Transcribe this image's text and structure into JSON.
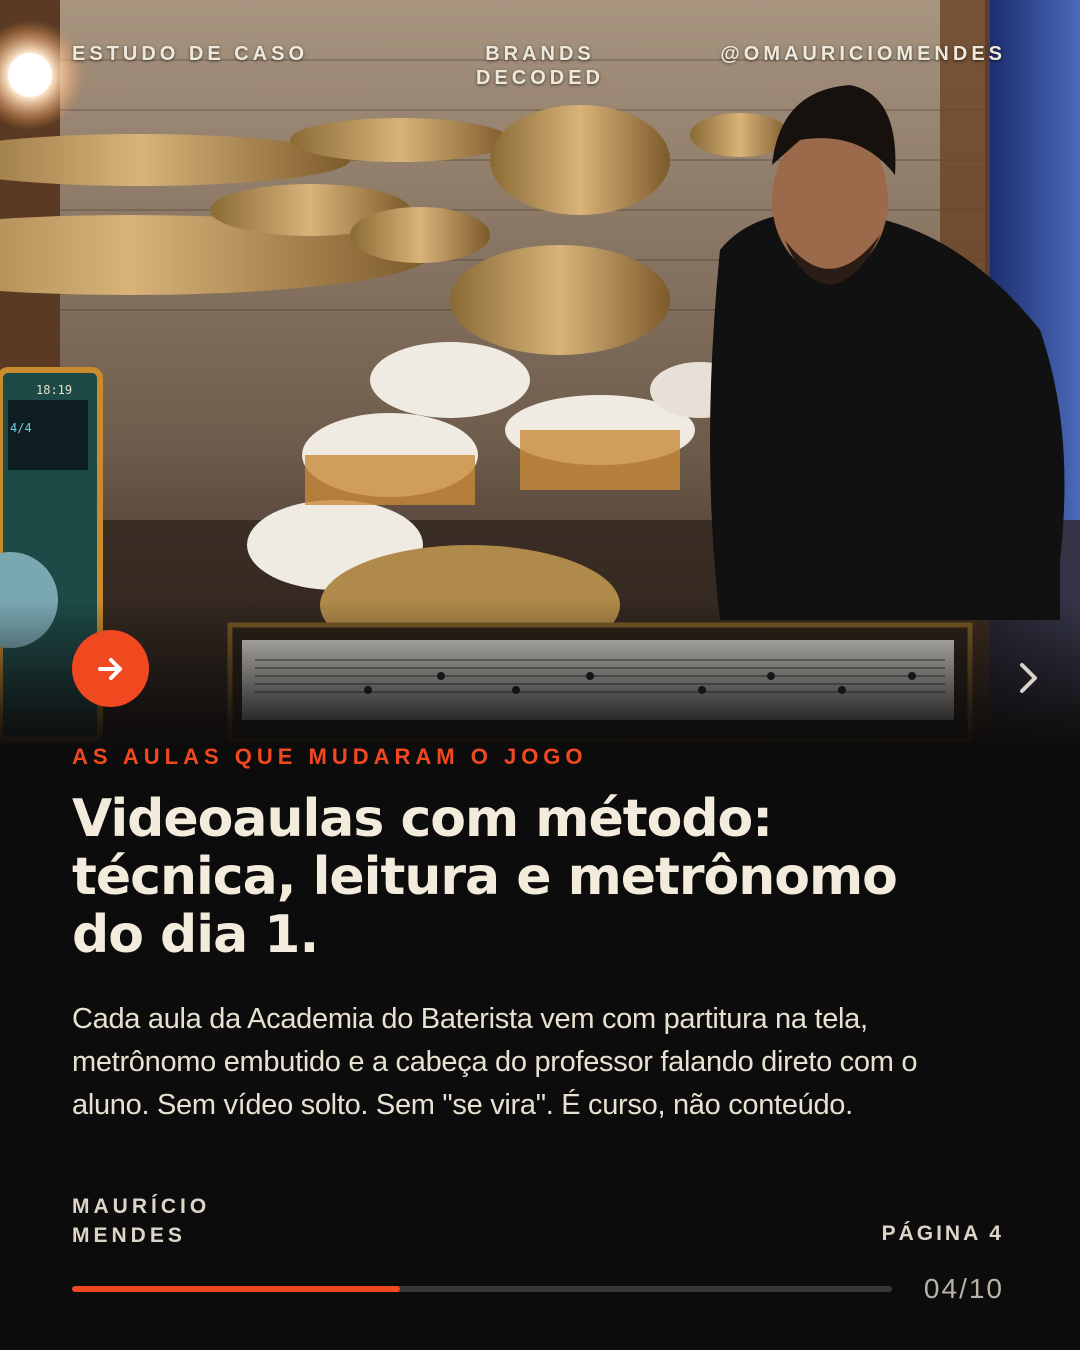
{
  "header": {
    "left": "ESTUDO DE CASO",
    "center_line1": "BRANDS",
    "center_line2": "DECODED",
    "right": "@OMAURICIOMENDES"
  },
  "hero": {
    "screen_time": "18:19",
    "screen_signature": "4/4",
    "next_icon": "arrow-right-icon",
    "chevron_icon": "chevron-right-icon"
  },
  "content": {
    "eyebrow": "AS AULAS QUE MUDARAM O JOGO",
    "headline": "Videoaulas com método: técnica, leitura e metrônomo do dia 1.",
    "body": "Cada aula da Academia do Baterista vem com partitura na tela, metrônomo embutido e a cabeça do professor falando direto com o aluno. Sem vídeo solto. Sem \"se vira\". É curso, não conteúdo."
  },
  "footer": {
    "author_line1": "MAURÍCIO",
    "author_line2": "MENDES",
    "page_label": "PÁGINA 4",
    "counter": "04/10",
    "progress": 0.4
  },
  "colors": {
    "accent": "#f0481f",
    "background": "#0d0c0c",
    "text": "#f3ecdc"
  }
}
